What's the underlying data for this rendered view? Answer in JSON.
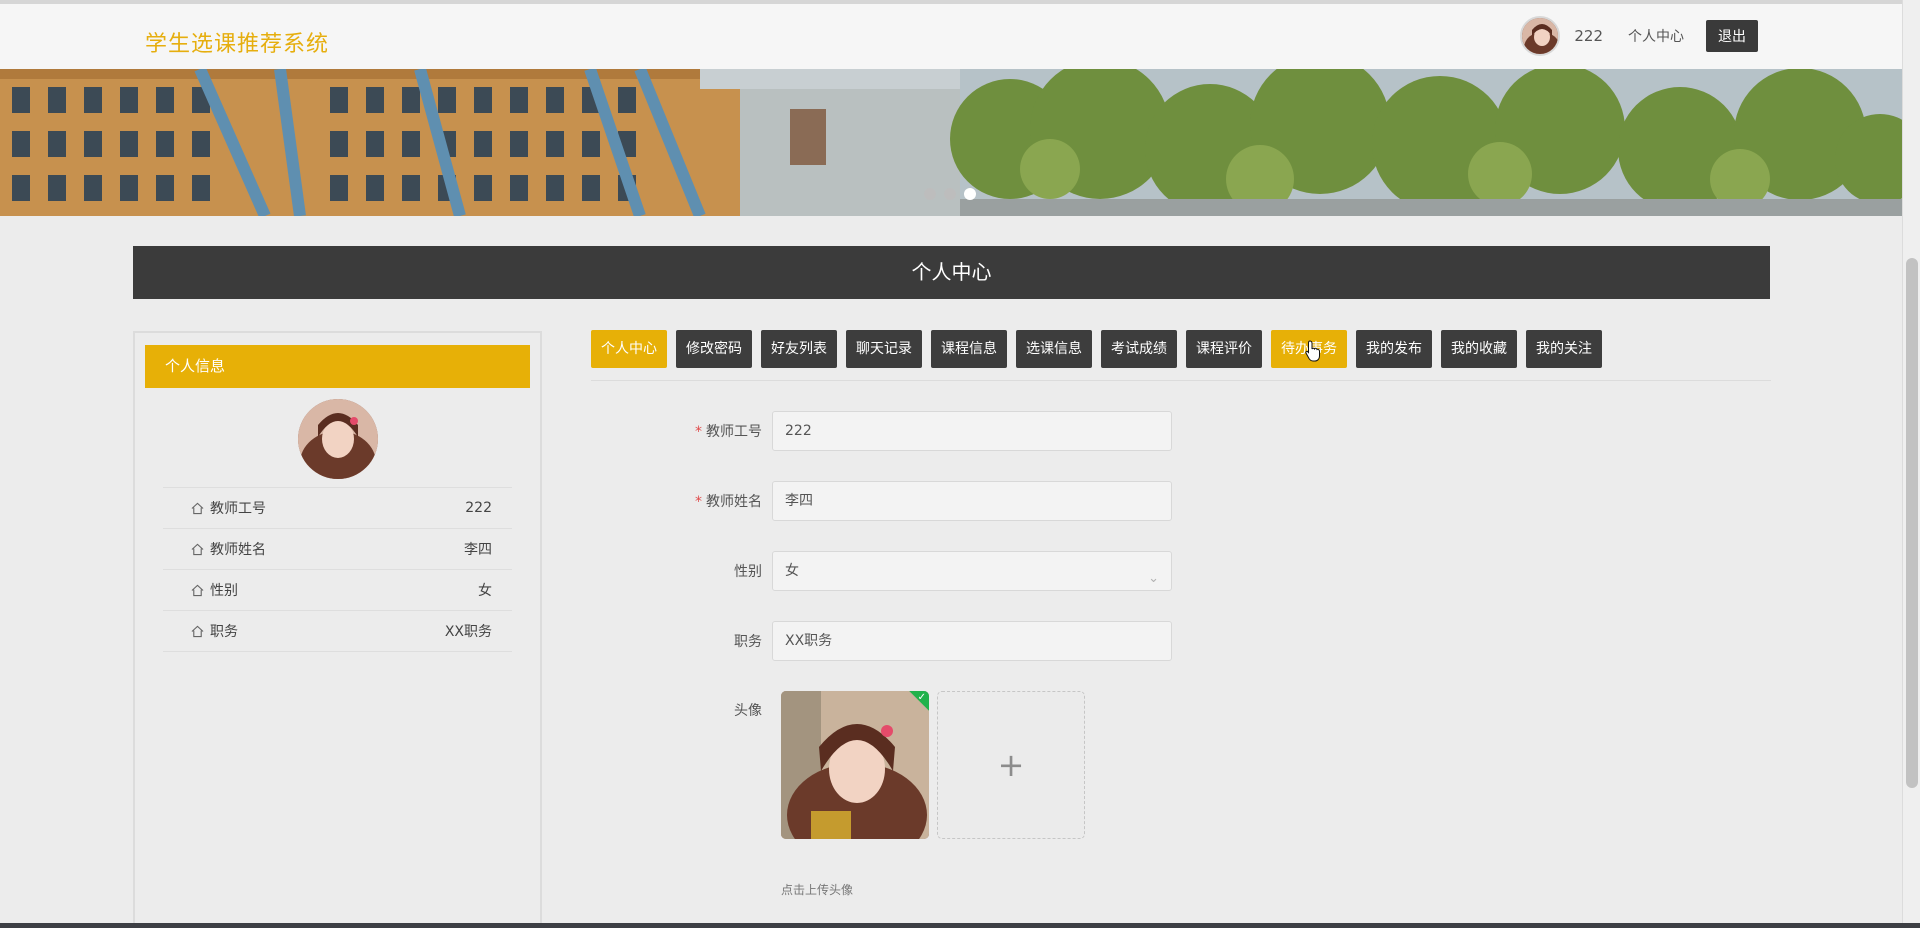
{
  "header": {
    "brand": "学生选课推荐系统",
    "username": "222",
    "personal_center": "个人中心",
    "logout": "退出"
  },
  "banner": {
    "slide_count": 3,
    "active_slide": 3
  },
  "section_title": "个人中心",
  "left_panel": {
    "title": "个人信息",
    "rows": [
      {
        "label": "教师工号",
        "value": "222"
      },
      {
        "label": "教师姓名",
        "value": "李四"
      },
      {
        "label": "性别",
        "value": "女"
      },
      {
        "label": "职务",
        "value": "XX职务"
      }
    ]
  },
  "tabs": [
    "个人中心",
    "修改密码",
    "好友列表",
    "聊天记录",
    "课程信息",
    "选课信息",
    "考试成绩",
    "课程评价",
    "待办事务",
    "我的发布",
    "我的收藏",
    "我的关注"
  ],
  "active_tab": "个人中心",
  "hover_tab": "待办事务",
  "form": {
    "teacher_id_label": "教师工号",
    "teacher_id_value": "222",
    "teacher_name_label": "教师姓名",
    "teacher_name_value": "李四",
    "gender_label": "性别",
    "gender_value": "女",
    "position_label": "职务",
    "position_value": "XX职务",
    "avatar_label": "头像",
    "upload_hint": "点击上传头像"
  },
  "colors": {
    "accent": "#e7b007",
    "dark": "#3b3b3b",
    "brand_text": "#e6ae0e",
    "success": "#21b24b"
  }
}
